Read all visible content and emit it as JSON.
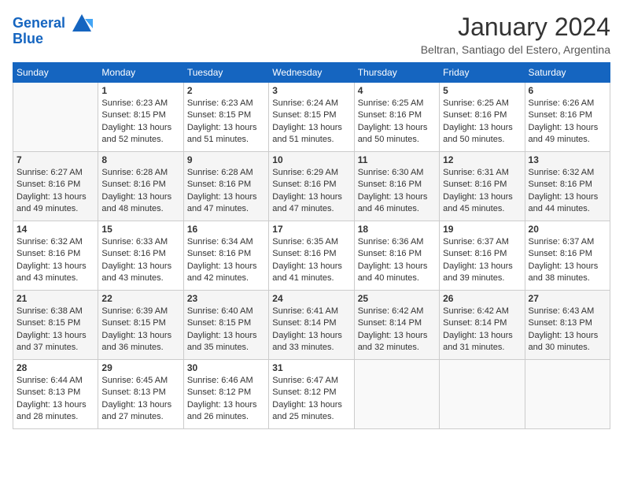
{
  "header": {
    "logo_line1": "General",
    "logo_line2": "Blue",
    "month_title": "January 2024",
    "location": "Beltran, Santiago del Estero, Argentina"
  },
  "days_of_week": [
    "Sunday",
    "Monday",
    "Tuesday",
    "Wednesday",
    "Thursday",
    "Friday",
    "Saturday"
  ],
  "weeks": [
    [
      {
        "day": "",
        "info": ""
      },
      {
        "day": "1",
        "info": "Sunrise: 6:23 AM\nSunset: 8:15 PM\nDaylight: 13 hours\nand 52 minutes."
      },
      {
        "day": "2",
        "info": "Sunrise: 6:23 AM\nSunset: 8:15 PM\nDaylight: 13 hours\nand 51 minutes."
      },
      {
        "day": "3",
        "info": "Sunrise: 6:24 AM\nSunset: 8:15 PM\nDaylight: 13 hours\nand 51 minutes."
      },
      {
        "day": "4",
        "info": "Sunrise: 6:25 AM\nSunset: 8:16 PM\nDaylight: 13 hours\nand 50 minutes."
      },
      {
        "day": "5",
        "info": "Sunrise: 6:25 AM\nSunset: 8:16 PM\nDaylight: 13 hours\nand 50 minutes."
      },
      {
        "day": "6",
        "info": "Sunrise: 6:26 AM\nSunset: 8:16 PM\nDaylight: 13 hours\nand 49 minutes."
      }
    ],
    [
      {
        "day": "7",
        "info": "Sunrise: 6:27 AM\nSunset: 8:16 PM\nDaylight: 13 hours\nand 49 minutes."
      },
      {
        "day": "8",
        "info": "Sunrise: 6:28 AM\nSunset: 8:16 PM\nDaylight: 13 hours\nand 48 minutes."
      },
      {
        "day": "9",
        "info": "Sunrise: 6:28 AM\nSunset: 8:16 PM\nDaylight: 13 hours\nand 47 minutes."
      },
      {
        "day": "10",
        "info": "Sunrise: 6:29 AM\nSunset: 8:16 PM\nDaylight: 13 hours\nand 47 minutes."
      },
      {
        "day": "11",
        "info": "Sunrise: 6:30 AM\nSunset: 8:16 PM\nDaylight: 13 hours\nand 46 minutes."
      },
      {
        "day": "12",
        "info": "Sunrise: 6:31 AM\nSunset: 8:16 PM\nDaylight: 13 hours\nand 45 minutes."
      },
      {
        "day": "13",
        "info": "Sunrise: 6:32 AM\nSunset: 8:16 PM\nDaylight: 13 hours\nand 44 minutes."
      }
    ],
    [
      {
        "day": "14",
        "info": "Sunrise: 6:32 AM\nSunset: 8:16 PM\nDaylight: 13 hours\nand 43 minutes."
      },
      {
        "day": "15",
        "info": "Sunrise: 6:33 AM\nSunset: 8:16 PM\nDaylight: 13 hours\nand 43 minutes."
      },
      {
        "day": "16",
        "info": "Sunrise: 6:34 AM\nSunset: 8:16 PM\nDaylight: 13 hours\nand 42 minutes."
      },
      {
        "day": "17",
        "info": "Sunrise: 6:35 AM\nSunset: 8:16 PM\nDaylight: 13 hours\nand 41 minutes."
      },
      {
        "day": "18",
        "info": "Sunrise: 6:36 AM\nSunset: 8:16 PM\nDaylight: 13 hours\nand 40 minutes."
      },
      {
        "day": "19",
        "info": "Sunrise: 6:37 AM\nSunset: 8:16 PM\nDaylight: 13 hours\nand 39 minutes."
      },
      {
        "day": "20",
        "info": "Sunrise: 6:37 AM\nSunset: 8:16 PM\nDaylight: 13 hours\nand 38 minutes."
      }
    ],
    [
      {
        "day": "21",
        "info": "Sunrise: 6:38 AM\nSunset: 8:15 PM\nDaylight: 13 hours\nand 37 minutes."
      },
      {
        "day": "22",
        "info": "Sunrise: 6:39 AM\nSunset: 8:15 PM\nDaylight: 13 hours\nand 36 minutes."
      },
      {
        "day": "23",
        "info": "Sunrise: 6:40 AM\nSunset: 8:15 PM\nDaylight: 13 hours\nand 35 minutes."
      },
      {
        "day": "24",
        "info": "Sunrise: 6:41 AM\nSunset: 8:14 PM\nDaylight: 13 hours\nand 33 minutes."
      },
      {
        "day": "25",
        "info": "Sunrise: 6:42 AM\nSunset: 8:14 PM\nDaylight: 13 hours\nand 32 minutes."
      },
      {
        "day": "26",
        "info": "Sunrise: 6:42 AM\nSunset: 8:14 PM\nDaylight: 13 hours\nand 31 minutes."
      },
      {
        "day": "27",
        "info": "Sunrise: 6:43 AM\nSunset: 8:13 PM\nDaylight: 13 hours\nand 30 minutes."
      }
    ],
    [
      {
        "day": "28",
        "info": "Sunrise: 6:44 AM\nSunset: 8:13 PM\nDaylight: 13 hours\nand 28 minutes."
      },
      {
        "day": "29",
        "info": "Sunrise: 6:45 AM\nSunset: 8:13 PM\nDaylight: 13 hours\nand 27 minutes."
      },
      {
        "day": "30",
        "info": "Sunrise: 6:46 AM\nSunset: 8:12 PM\nDaylight: 13 hours\nand 26 minutes."
      },
      {
        "day": "31",
        "info": "Sunrise: 6:47 AM\nSunset: 8:12 PM\nDaylight: 13 hours\nand 25 minutes."
      },
      {
        "day": "",
        "info": ""
      },
      {
        "day": "",
        "info": ""
      },
      {
        "day": "",
        "info": ""
      }
    ]
  ]
}
